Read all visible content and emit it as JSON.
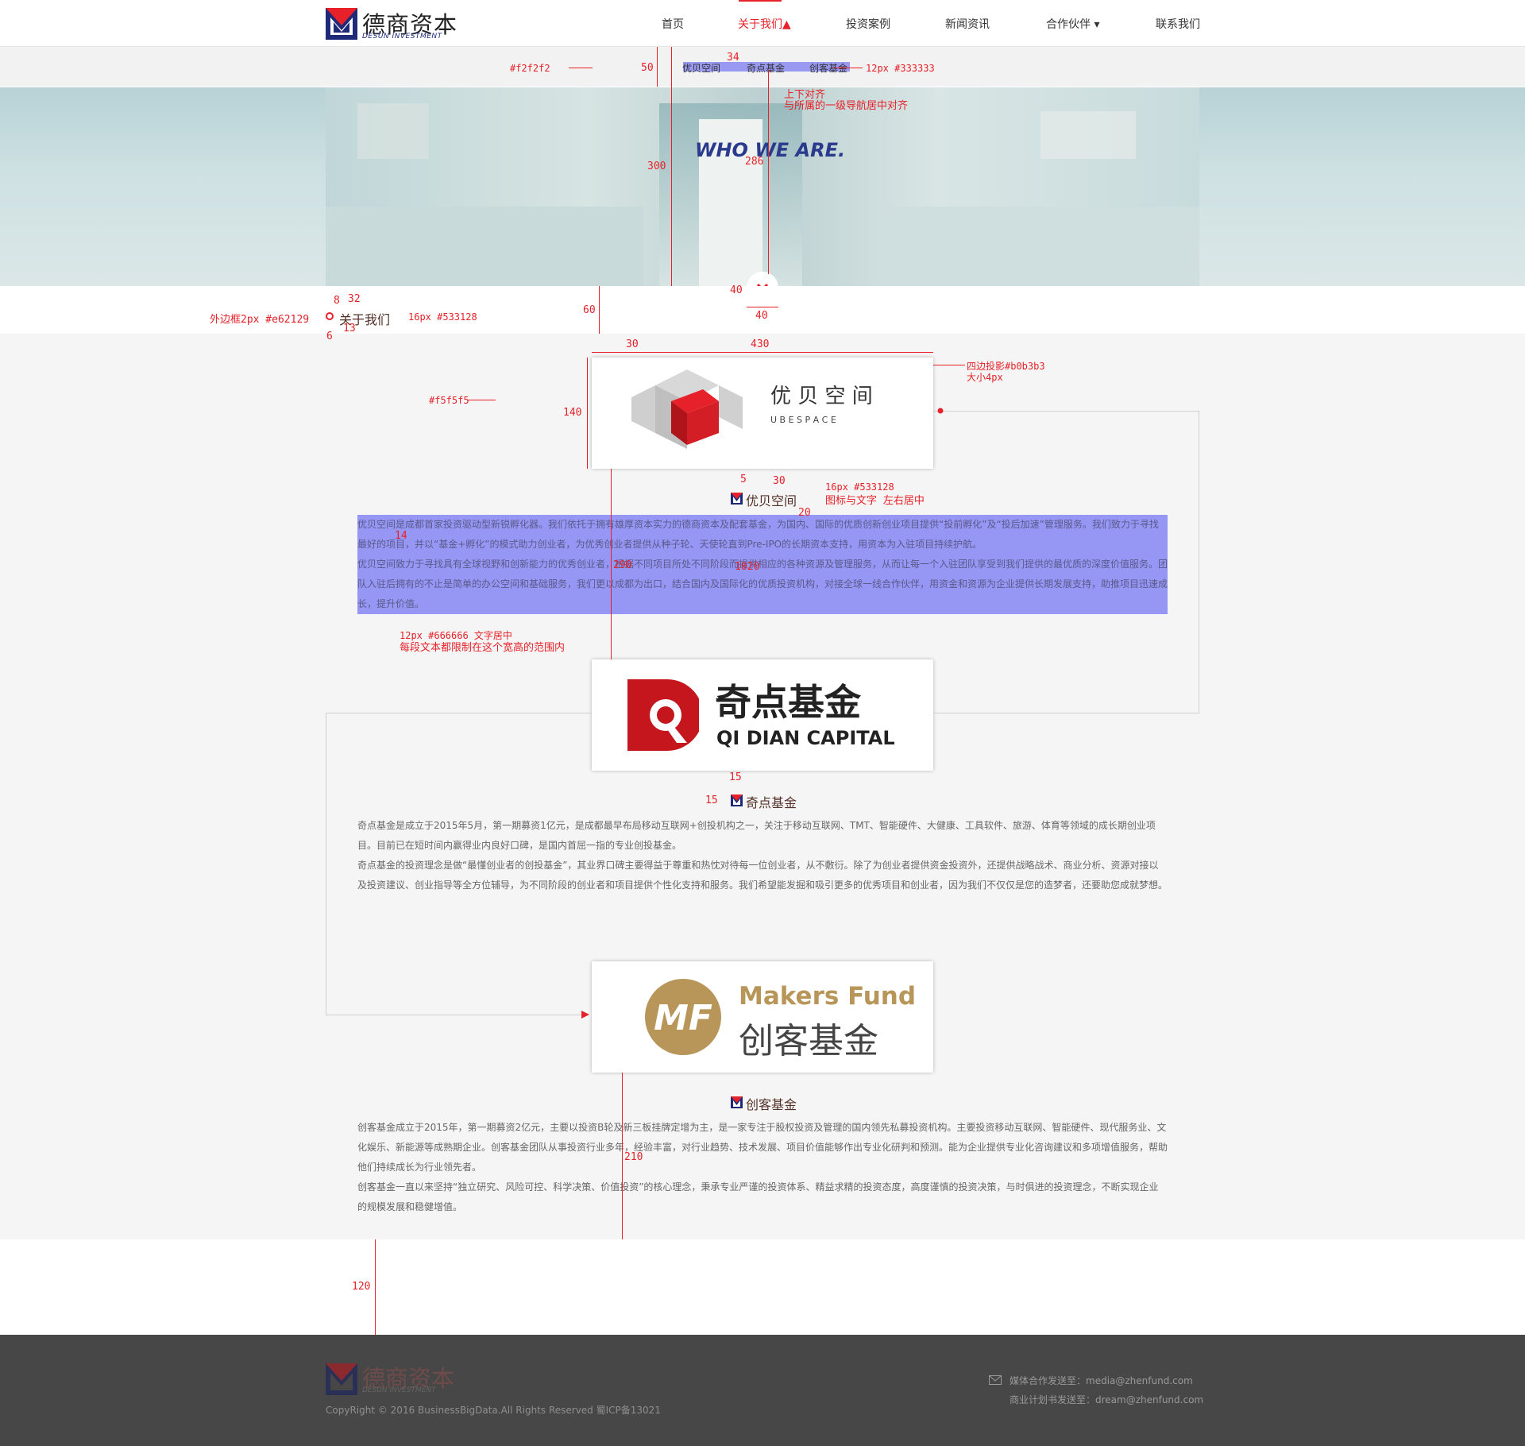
{
  "header": {
    "logo_cn": "德商资本",
    "logo_en": "DESUN INVESTMENT",
    "nav": [
      "首页",
      "关于我们▲",
      "投资案例",
      "新闻资讯",
      "合作伙伴 ▾",
      "联系我们"
    ],
    "active_index": 1
  },
  "subnav": {
    "items": [
      "优贝空间",
      "奇点基金",
      "创客基金"
    ],
    "background": "#f2f2f2"
  },
  "banner": {
    "title": "WHO WE ARE."
  },
  "breadcrumb": {
    "label": "关于我们"
  },
  "companies": [
    {
      "name": "优贝空间",
      "logo_cn": "优 贝 空 间",
      "logo_en": "U B E S P A C E",
      "paragraphs": [
        "优贝空间是成都首家投资驱动型新锐孵化器。我们依托于拥有雄厚资本实力的德商资本及配套基金，为国内、国际的优质创新创业项目提供“投前孵化”及“投后加速”管理服务。我们致力于寻找最好的项目，并以“基金+孵化”的模式助力创业者，为优秀创业者提供从种子轮、天使轮直到Pre-IPO的长期资本支持，用资本为入驻项目持续护航。",
        "优贝空间致力于寻找具有全球视野和创新能力的优秀创业者，根据不同项目所处不同阶段而提供相应的各种资源及管理服务，从而让每一个入驻团队享受到我们提供的最优质的深度价值服务。团队入驻后拥有的不止是简单的办公空间和基础服务，我们更以成都为出口，结合国内及国际化的优质投资机构，对接全球一线合作伙伴，用资金和资源为企业提供长期发展支持，助推项目迅速成长，提升价值。"
      ]
    },
    {
      "name": "奇点基金",
      "logo_cn": "奇点基金",
      "logo_en": "QI DIAN CAPITAL",
      "paragraphs": [
        "奇点基金是成立于2015年5月，第一期募资1亿元，是成都最早布局移动互联网+创投机构之一，关注于移动互联网、TMT、智能硬件、大健康、工具软件、旅游、体育等领域的成长期创业项目。目前已在短时间内赢得业内良好口碑，是国内首屈一指的专业创投基金。",
        "奇点基金的投资理念是做“最懂创业者的创投基金”，其业界口碑主要得益于尊重和热忱对待每一位创业者，从不敷衍。除了为创业者提供资金投资外，还提供战略战术、商业分析、资源对接以及投资建议、创业指导等全方位辅导，为不同阶段的创业者和项目提供个性化支持和服务。我们希望能发掘和吸引更多的优秀项目和创业者，因为我们不仅仅是您的造梦者，还要助您成就梦想。"
      ]
    },
    {
      "name": "创客基金",
      "logo_cn": "创客基金",
      "logo_en": "Makers Fund",
      "logo_mark": "MF",
      "paragraphs": [
        "创客基金成立于2015年，第一期募资2亿元，主要以投资B轮及新三板挂牌定增为主，是一家专注于股权投资及管理的国内领先私募投资机构。主要投资移动互联网、智能硬件、现代服务业、文化娱乐、新能源等成熟期企业。创客基金团队从事投资行业多年，经验丰富，对行业趋势、技术发展、项目价值能够作出专业化研判和预测。能为企业提供专业化咨询建议和多项增值服务，帮助他们持续成长为行业领先者。",
        "创客基金一直以来坚持“独立研究、风险可控、科学决策、价值投资”的核心理念，秉承专业严谨的投资体系、精益求精的投资态度，高度谨慎的投资决策，与时俱进的投资理念，不断实现企业的规模发展和稳健增值。"
      ]
    }
  ],
  "footer": {
    "logo_cn": "德商资本",
    "logo_en": "DESUN INVESTMENT",
    "copyright": "CopyRight © 2016 BusinessBigData.All Rights Reserved 蜀ICP备13021",
    "contact_media": "媒体合作发送至：media@zhenfund.com",
    "contact_plan": "商业计划书发送至：dream@zhenfund.com"
  },
  "annotations": {
    "subnav_bg": "#f2f2f2",
    "subnav_height": "50",
    "subnav_gap": "34",
    "subnav_font": "12px #333333",
    "align1": "上下对齐",
    "align2": "与所属的一级导航居中对齐",
    "banner_h": "300",
    "banner_inner": "286",
    "arrow_h": "40",
    "arrow_w": "40",
    "crumb_border": "外边框2px #e62129",
    "crumb_8": "8",
    "crumb_32": "32",
    "crumb_font": "16px #533128",
    "crumb_6": "6",
    "crumb_13": "13",
    "gap_60": "60",
    "gap_30": "30",
    "card_w": "430",
    "card_shadow1": "四边投影#b0b3b3",
    "card_shadow2": "大小4px",
    "content_bg": "#f5f5f5",
    "card_h": "140",
    "n5": "5",
    "n30": "30",
    "title_font": "16px #533128",
    "title_center": "图标与文字 左右居中",
    "n20": "20",
    "n14": "14",
    "para_font": "12px #666666 文字居中",
    "para_limit": "每段文本都限制在这个宽高的范围内",
    "p_label1": "290",
    "p_label2": "1020",
    "n15a": "15",
    "n15b": "15",
    "n210": "210",
    "n120": "120"
  }
}
